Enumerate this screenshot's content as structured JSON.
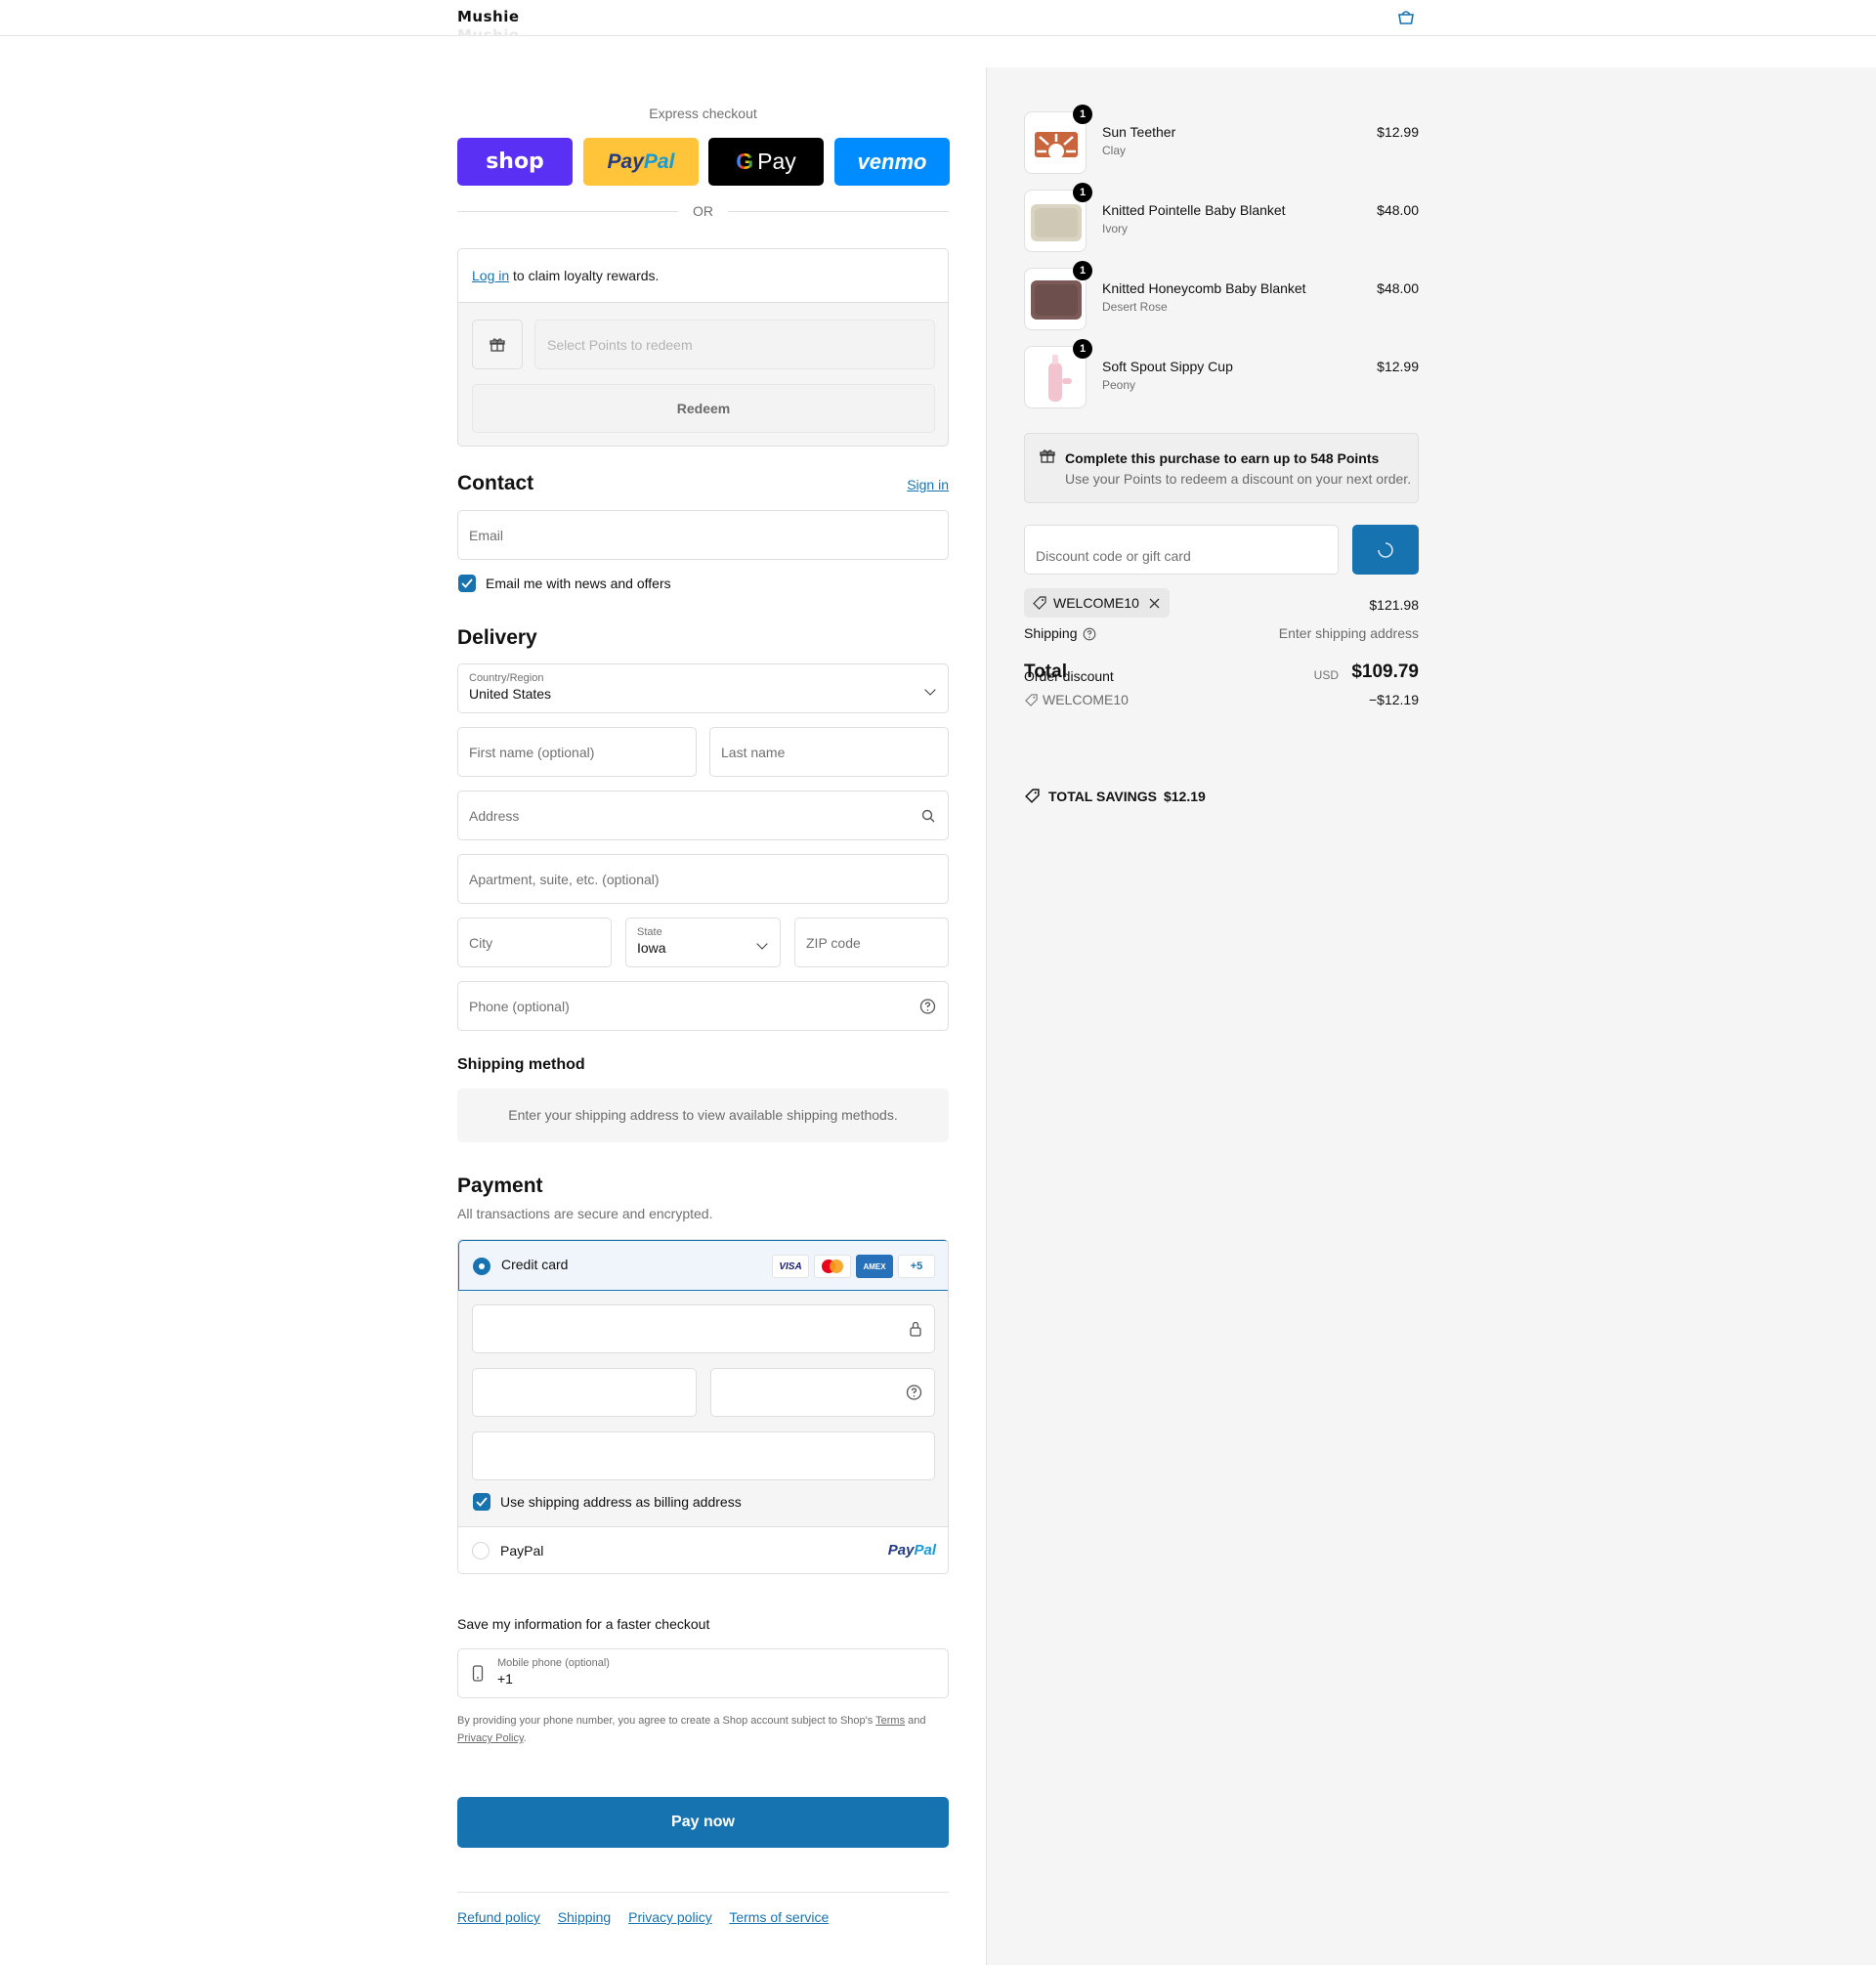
{
  "header": {
    "brand": "Mushie",
    "cart_icon": "bag-icon"
  },
  "express": {
    "title": "Express checkout",
    "buttons": {
      "shop": "shop",
      "paypal_a": "Pay",
      "paypal_b": "Pal",
      "gpay_g": "G",
      "gpay_text": "Pay",
      "venmo": "venmo"
    },
    "or": "OR"
  },
  "loyalty": {
    "login_link": "Log in",
    "login_text": " to claim loyalty rewards.",
    "points_placeholder": "Select Points to redeem",
    "redeem": "Redeem"
  },
  "contact": {
    "title": "Contact",
    "sign_in": "Sign in",
    "email_placeholder": "Email",
    "news_label": "Email me with news and offers",
    "news_checked": true
  },
  "delivery": {
    "title": "Delivery",
    "country_label": "Country/Region",
    "country_value": "United States",
    "first_name": "First name (optional)",
    "last_name": "Last name",
    "address": "Address",
    "apartment": "Apartment, suite, etc. (optional)",
    "city": "City",
    "state_label": "State",
    "state_value": "Iowa",
    "zip": "ZIP code",
    "phone": "Phone (optional)"
  },
  "shipping_method": {
    "title": "Shipping method",
    "message": "Enter your shipping address to view available shipping methods."
  },
  "payment": {
    "title": "Payment",
    "subtitle": "All transactions are secure and encrypted.",
    "credit_card": "Credit card",
    "card_logos": {
      "visa": "VISA",
      "amex": "AMEX",
      "more": "+5"
    },
    "billing_label": "Use shipping address as billing address",
    "billing_checked": true,
    "paypal_label": "PayPal",
    "paypal_logo_a": "Pay",
    "paypal_logo_b": "Pal"
  },
  "save_info": {
    "title": "Save my information for a faster checkout",
    "phone_label": "Mobile phone (optional)",
    "phone_value": "+1",
    "legal_a": "By providing your phone number, you agree to create a Shop account subject to Shop's ",
    "legal_terms": "Terms",
    "legal_b": " and ",
    "legal_privacy": "Privacy Policy",
    "legal_c": "."
  },
  "pay_now": "Pay now",
  "footer_links": [
    "Refund policy",
    "Shipping",
    "Privacy policy",
    "Terms of service"
  ],
  "cart": {
    "items": [
      {
        "qty": "1",
        "name": "Sun Teether",
        "variant": "Clay",
        "price": "$12.99",
        "color": "#c8653c"
      },
      {
        "qty": "1",
        "name": "Knitted Pointelle Baby Blanket",
        "variant": "Ivory",
        "price": "$48.00",
        "color": "#d9d3c2"
      },
      {
        "qty": "1",
        "name": "Knitted Honeycomb Baby Blanket",
        "variant": "Desert Rose",
        "price": "$48.00",
        "color": "#7b5a58"
      },
      {
        "qty": "1",
        "name": "Soft Spout Sippy Cup",
        "variant": "Peony",
        "price": "$12.99",
        "color": "#f2c4cf"
      }
    ],
    "earn_title": "Complete this purchase to earn up to 548 Points",
    "earn_sub": "Use your Points to redeem a discount on your next order.",
    "discount_placeholder": "Discount code or gift card",
    "applied_code": "WELCOME10",
    "subtotal": "$121.98",
    "shipping_label": "Shipping",
    "shipping_value": "Enter shipping address",
    "order_discount_label": "Order discount",
    "total_label": "Total",
    "total_currency": "USD",
    "total_value": "$109.79",
    "discount_code": "WELCOME10",
    "discount_value": "−$12.19",
    "savings_label": "TOTAL SAVINGS",
    "savings_value": "$12.19"
  },
  "colors": {
    "accent": "#1773b0",
    "shop": "#5a31f4",
    "paypal": "#ffc439",
    "venmo": "#008cff"
  }
}
